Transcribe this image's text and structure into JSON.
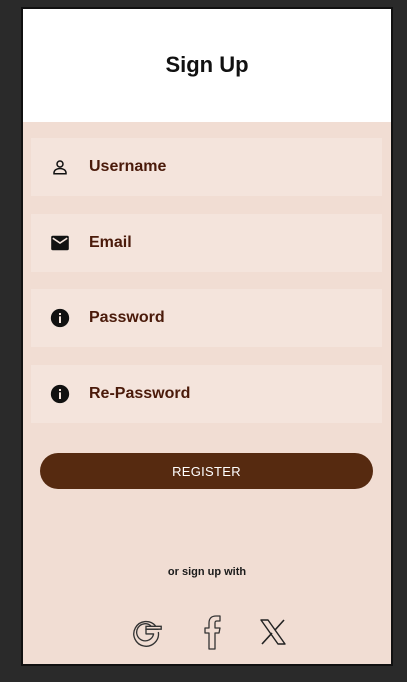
{
  "header": {
    "title": "Sign Up"
  },
  "fields": {
    "username": {
      "label": "Username",
      "icon": "person-icon"
    },
    "email": {
      "label": "Email",
      "icon": "mail-icon"
    },
    "password": {
      "label": "Password",
      "icon": "info-icon"
    },
    "repassword": {
      "label": "Re-Password",
      "icon": "info-icon"
    }
  },
  "register": {
    "label": "REGISTER"
  },
  "social": {
    "caption": "or sign up with",
    "providers": [
      "google-icon",
      "facebook-icon",
      "x-icon"
    ]
  },
  "colors": {
    "background": "#f1ddd3",
    "field": "#f4e4dc",
    "accent": "#562a10",
    "label": "#4a1a0a"
  }
}
